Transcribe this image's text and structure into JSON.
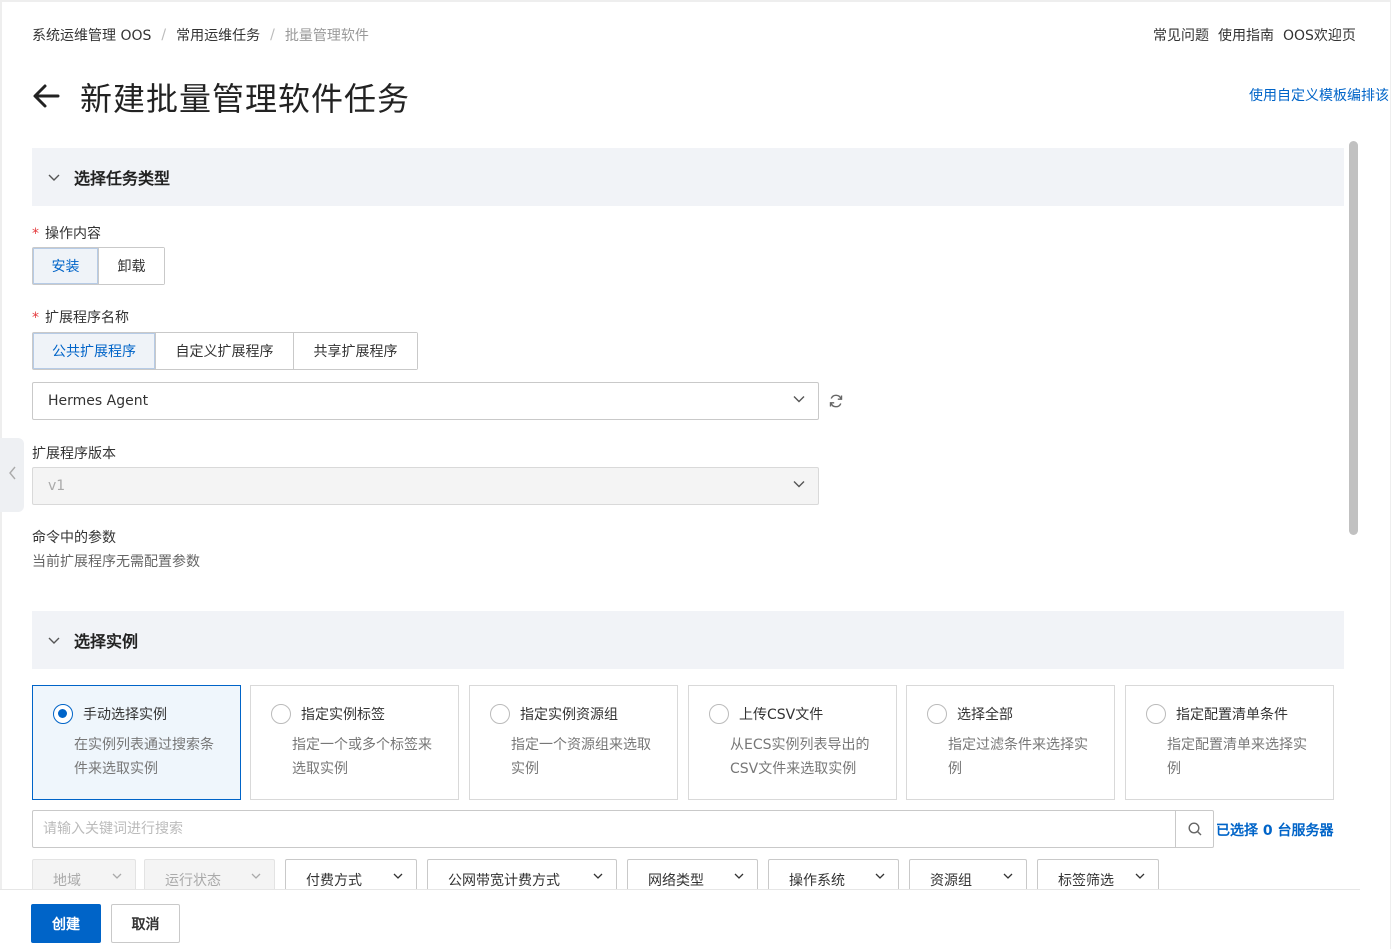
{
  "breadcrumb": {
    "items": [
      "系统运维管理 OOS",
      "常用运维任务",
      "批量管理软件"
    ],
    "separator": "/"
  },
  "header": {
    "links": [
      "常见问题",
      "使用指南",
      "OOS欢迎页"
    ],
    "title": "新建批量管理软件任务",
    "template_link": "使用自定义模板编排该"
  },
  "section_task_type": {
    "title": "选择任务类型",
    "operation": {
      "label": "操作内容",
      "options": [
        "安装",
        "卸载"
      ],
      "selected": "安装"
    },
    "extension_name": {
      "label": "扩展程序名称",
      "options": [
        "公共扩展程序",
        "自定义扩展程序",
        "共享扩展程序"
      ],
      "selected": "公共扩展程序",
      "value": "Hermes Agent"
    },
    "extension_version": {
      "label": "扩展程序版本",
      "value": "v1"
    },
    "params": {
      "label": "命令中的参数",
      "hint": "当前扩展程序无需配置参数"
    }
  },
  "section_instances": {
    "title": "选择实例",
    "cards": [
      {
        "title": "手动选择实例",
        "desc1": "在实例列表通过搜索条",
        "desc2": "件来选取实例",
        "selected": true
      },
      {
        "title": "指定实例标签",
        "desc1": "指定一个或多个标签来",
        "desc2": "选取实例",
        "selected": false
      },
      {
        "title": "指定实例资源组",
        "desc1": "指定一个资源组来选取",
        "desc2": "实例",
        "selected": false
      },
      {
        "title": "上传CSV文件",
        "desc1": "从ECS实例列表导出的",
        "desc2": "CSV文件来选取实例",
        "selected": false
      },
      {
        "title": "选择全部",
        "desc1": "指定过滤条件来选择实",
        "desc2": "例",
        "selected": false
      },
      {
        "title": "指定配置清单条件",
        "desc1": "指定配置清单来选择实",
        "desc2": "例",
        "selected": false
      }
    ],
    "search_placeholder": "请输入关键词进行搜索",
    "selected_count_text": "已选择 0 台服务器",
    "filters": [
      "地域",
      "运行状态",
      "付费方式",
      "公网带宽计费方式",
      "网络类型",
      "操作系统",
      "资源组",
      "标签筛选"
    ]
  },
  "footer": {
    "create": "创建",
    "cancel": "取消"
  },
  "colors": {
    "accent": "#0064c8",
    "required": "#e4393c",
    "section_bg": "#f1f3f7"
  }
}
